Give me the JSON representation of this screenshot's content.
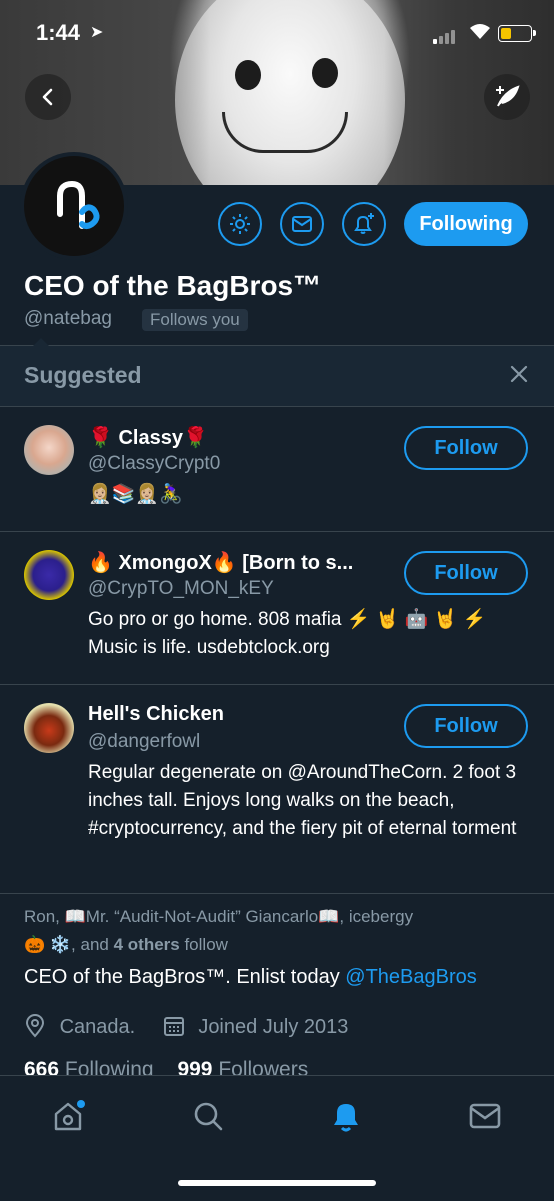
{
  "status": {
    "time": "1:44"
  },
  "profile": {
    "name": "CEO of the BagBros™",
    "handle": "@natebag",
    "follows_you": "Follows you",
    "following_label": "Following"
  },
  "suggested": {
    "title": "Suggested",
    "items": [
      {
        "name": "🌹 Classy🌹",
        "handle": "@ClassyCrypt0",
        "bio": "👩🏼‍⚕️📚👩🏼‍⚕️🚴‍♀️",
        "button": "Follow"
      },
      {
        "name": "🔥 XmongoX🔥 [Born to s...",
        "handle": "@CrypTO_MON_kEY",
        "bio": "Go pro or go home. 808 mafia ⚡️ 🤘 🤖 🤘 ⚡️  Music is life. usdebtclock.org",
        "button": "Follow"
      },
      {
        "name": "Hell's Chicken",
        "handle": "@dangerfowl",
        "bio": "Regular degenerate on @AroundTheCorn. 2 foot 3 inches tall. Enjoys long walks on the beach, #cryptocurrency, and the fiery pit of eternal torment",
        "button": "Follow"
      }
    ]
  },
  "context": {
    "line1": "Ron, 📖Mr. “Audit-Not-Audit” Giancarlo📖, icebergy",
    "line2_pre": "🎃 ❄️, and ",
    "line2_bold": "4 others",
    "line2_post": " follow"
  },
  "bio": {
    "text": "CEO of the BagBros™. Enlist today ",
    "link": "@TheBagBros"
  },
  "meta": {
    "location": "Canada.",
    "joined": "Joined July 2013"
  },
  "stats": {
    "following_count": "666",
    "following_label": "Following",
    "followers_count": "999",
    "followers_label": "Followers"
  },
  "colors": {
    "accent": "#1d9bf0",
    "background": "#15202b",
    "secondary_text": "#8899a6"
  }
}
